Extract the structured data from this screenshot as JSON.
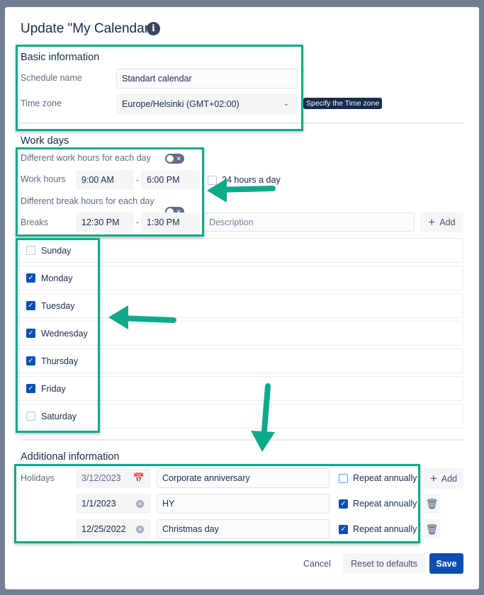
{
  "dialog": {
    "title": "Update \"My Calendar\"",
    "info_icon": "i"
  },
  "basic": {
    "heading": "Basic information",
    "schedule_label": "Schedule name",
    "schedule_value": "Standart calendar",
    "tz_label": "Time zone",
    "tz_value": "Europe/Helsinki (GMT+02:00)",
    "tooltip": "Specify the Time zone"
  },
  "work": {
    "heading": "Work days",
    "diff_work_label": "Different work hours for each day",
    "work_hours_label": "Work hours",
    "work_start": "9:00 AM",
    "work_end": "6:00 PM",
    "dash": "-",
    "hours24_label": "24 hours a day",
    "diff_break_label": "Different break hours for each day",
    "breaks_label": "Breaks",
    "break_start": "12:30 PM",
    "break_end": "1:30 PM",
    "description_placeholder": "Description",
    "add_label": "Add",
    "days": [
      {
        "name": "Sunday",
        "checked": false
      },
      {
        "name": "Monday",
        "checked": true
      },
      {
        "name": "Tuesday",
        "checked": true
      },
      {
        "name": "Wednesday",
        "checked": true
      },
      {
        "name": "Thursday",
        "checked": true
      },
      {
        "name": "Friday",
        "checked": true
      },
      {
        "name": "Saturday",
        "checked": false
      }
    ]
  },
  "additional": {
    "heading": "Additional information",
    "holidays_label": "Holidays",
    "add_label": "Add",
    "repeat_label": "Repeat annually",
    "holidays": [
      {
        "date": "3/12/2023",
        "name": "Corporate anniversary",
        "repeat": false
      },
      {
        "date": "1/1/2023",
        "name": "HY",
        "repeat": true
      },
      {
        "date": "12/25/2022",
        "name": "Christmas day",
        "repeat": true
      }
    ]
  },
  "footer": {
    "cancel": "Cancel",
    "reset": "Reset to defaults",
    "save": "Save"
  },
  "colors": {
    "accent": "#0b4fb5",
    "annotation": "#0daa8a"
  }
}
